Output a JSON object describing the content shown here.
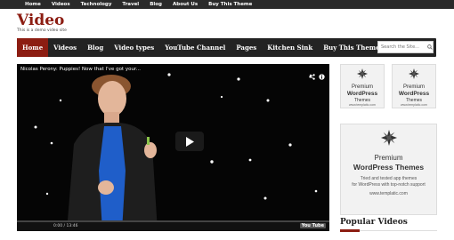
{
  "topbar": {
    "items": [
      "Home",
      "Videos",
      "Technology",
      "Travel",
      "Blog",
      "About Us",
      "Buy This Theme"
    ]
  },
  "site": {
    "title": "Video",
    "tagline": "This is a demo video site"
  },
  "nav": {
    "items": [
      "Home",
      "Videos",
      "Blog",
      "Video types",
      "YouTube Channel",
      "Pages",
      "Kitchen Sink",
      "Buy This Theme"
    ],
    "active": "Home",
    "search_placeholder": "Search the Site..."
  },
  "player": {
    "title": "Nicolas Perony: Puppies! Now that I've got your...",
    "time": "0:00 / 13:46",
    "progress_fraction": 0.0,
    "logo": "You Tube"
  },
  "ads": {
    "small": {
      "line1": "Premium",
      "line2": "WordPress",
      "line3": "Themes",
      "url": "www.templatic.com"
    },
    "big": {
      "line1": "Premium",
      "line2": "WordPress Themes",
      "line3a": "Tried and tested app themes",
      "line3b": "for WordPress with top-notch support",
      "url": "www.templatic.com"
    }
  },
  "sidebar": {
    "popular_title": "Popular Videos"
  },
  "colors": {
    "brand": "#8c1d12",
    "nav_bg": "#232323",
    "topbar_bg": "#2a2a2a"
  }
}
